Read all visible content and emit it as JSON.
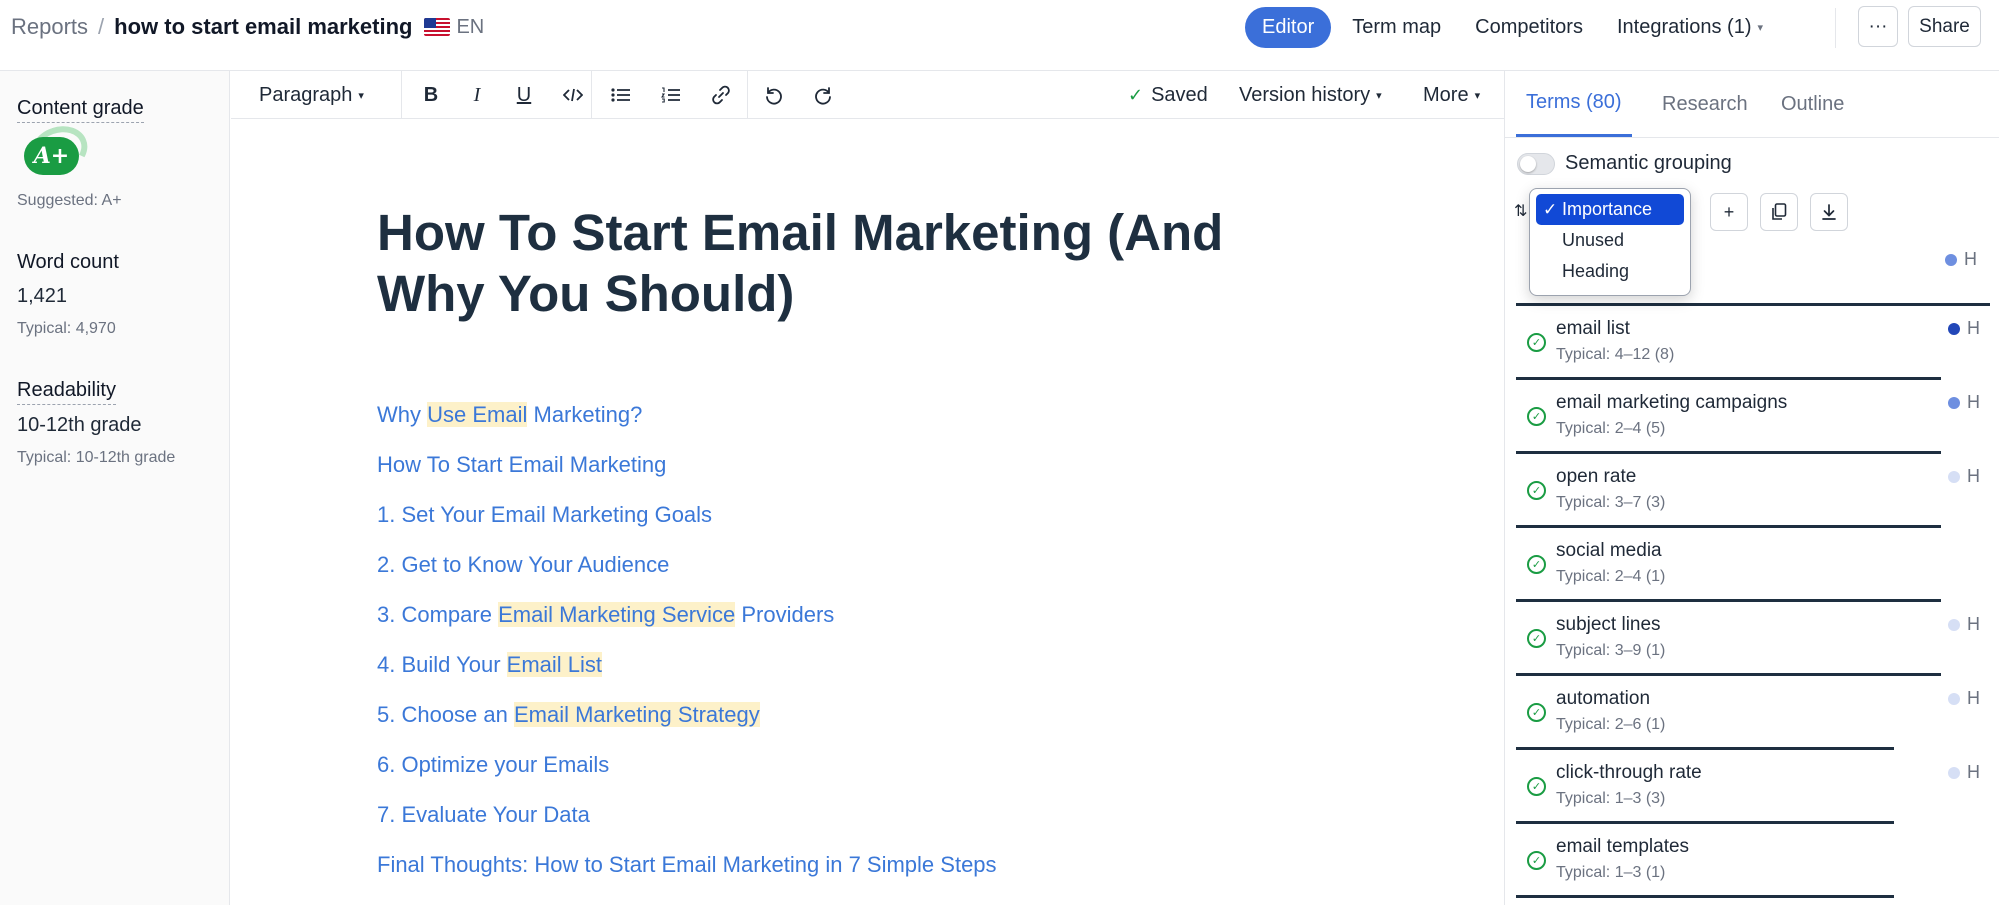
{
  "header": {
    "breadcrumb_root": "Reports",
    "breadcrumb_sep": "/",
    "report_title": "how to start email marketing",
    "language": "EN",
    "nav": {
      "editor": "Editor",
      "term_map": "Term map",
      "competitors": "Competitors",
      "integrations": "Integrations (1)"
    },
    "more_label": "···",
    "share_label": "Share"
  },
  "stats": {
    "content_grade_label": "Content grade",
    "content_grade": "A+",
    "suggested": "Suggested: A+",
    "word_count_label": "Word count",
    "word_count": "1,421",
    "word_count_typical": "Typical: 4,970",
    "readability_label": "Readability",
    "readability": "10-12th grade",
    "readability_typical": "Typical: 10-12th grade"
  },
  "toolbar": {
    "block_type": "Paragraph",
    "saved": "Saved",
    "version_history": "Version history",
    "more": "More"
  },
  "document": {
    "title": "How To Start Email Marketing (And Why You Should)",
    "toc": [
      {
        "pre": "Why ",
        "hl": "Use Email",
        "post": " Marketing?"
      },
      {
        "pre": "How To Start Email Marketing",
        "hl": "",
        "post": ""
      },
      {
        "pre": "1. Set Your Email Marketing Goals",
        "hl": "",
        "post": ""
      },
      {
        "pre": "2. Get to Know Your Audience",
        "hl": "",
        "post": ""
      },
      {
        "pre": "3. Compare ",
        "hl": "Email Marketing Service",
        "post": " Providers"
      },
      {
        "pre": "4. Build Your ",
        "hl": "Email List",
        "post": ""
      },
      {
        "pre": "5. Choose an ",
        "hl": "Email Marketing Strategy",
        "post": ""
      },
      {
        "pre": "6. Optimize your Emails",
        "hl": "",
        "post": ""
      },
      {
        "pre": "7. Evaluate Your Data",
        "hl": "",
        "post": ""
      },
      {
        "pre": "Final Thoughts: How to Start Email Marketing in 7 Simple Steps",
        "hl": "",
        "post": ""
      }
    ]
  },
  "terms_panel": {
    "tabs": [
      "Terms (80)",
      "Research",
      "Outline"
    ],
    "semantic_grouping": "Semantic grouping",
    "sort_options": [
      "Importance",
      "Unused",
      "Heading"
    ],
    "sort_selected": "Importance",
    "heading_marker": "H",
    "terms": [
      {
        "name": "email list",
        "typical": "Typical: 4–12 (8)",
        "dot": "#2247b8",
        "has_h": true
      },
      {
        "name": "email marketing campaigns",
        "typical": "Typical: 2–4 (5)",
        "dot": "#6e8fe0",
        "has_h": true
      },
      {
        "name": "open rate",
        "typical": "Typical: 3–7 (3)",
        "dot": "#d6dff5",
        "has_h": true
      },
      {
        "name": "social media",
        "typical": "Typical: 2–4 (1)",
        "dot": "",
        "has_h": false
      },
      {
        "name": "subject lines",
        "typical": "Typical: 3–9 (1)",
        "dot": "#d6dff5",
        "has_h": true
      },
      {
        "name": "automation",
        "typical": "Typical: 2–6 (1)",
        "dot": "#d6dff5",
        "has_h": true
      },
      {
        "name": "click-through rate",
        "typical": "Typical: 1–3 (3)",
        "dot": "#d6dff5",
        "has_h": true
      },
      {
        "name": "email templates",
        "typical": "Typical: 1–3 (1)",
        "dot": "",
        "has_h": false
      }
    ],
    "hidden_row_dot": "#6e8fe0"
  },
  "colors": {
    "accent": "#3b6fd9",
    "link": "#3b78d8",
    "grade_green": "#1a9c43",
    "highlight": "#fdf1c9"
  }
}
